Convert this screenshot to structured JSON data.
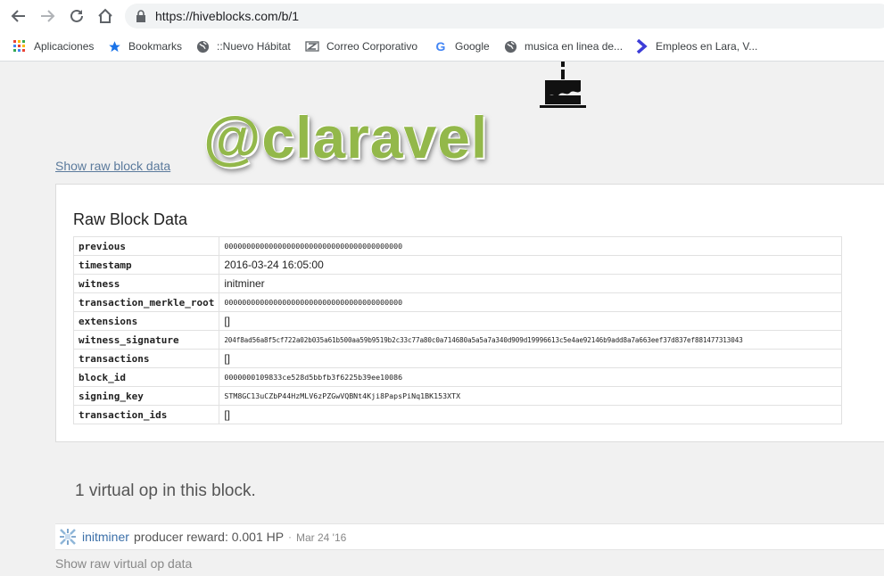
{
  "browser": {
    "url": "https://hiveblocks.com/b/1",
    "bookmarks": [
      {
        "label": "Aplicaciones",
        "icon": "apps-grid-icon"
      },
      {
        "label": "Bookmarks",
        "icon": "star-icon"
      },
      {
        "label": "::Nuevo Hábitat",
        "icon": "globe-icon"
      },
      {
        "label": "Correo Corporativo",
        "icon": "zimbra-icon"
      },
      {
        "label": "Google",
        "icon": "google-icon"
      },
      {
        "label": "musica en linea de...",
        "icon": "globe-icon"
      },
      {
        "label": "Empleos en Lara, V...",
        "icon": "arrow-logo-icon"
      }
    ]
  },
  "page": {
    "watermark": "@claravel",
    "show_raw_block": "Show raw block data",
    "panel_title": "Raw Block Data",
    "rows": [
      {
        "key": "previous",
        "value": "0000000000000000000000000000000000000000"
      },
      {
        "key": "timestamp",
        "value": "2016-03-24 16:05:00"
      },
      {
        "key": "witness",
        "value": "initminer"
      },
      {
        "key": "transaction_merkle_root",
        "value": "0000000000000000000000000000000000000000"
      },
      {
        "key": "extensions",
        "value": "[]"
      },
      {
        "key": "witness_signature",
        "value": "204f8ad56a8f5cf722a02b035a61b500aa59b9519b2c33c77a80c0a714680a5a5a7a340d909d19996613c5e4ae92146b9add8a7a663eef37d837ef881477313043"
      },
      {
        "key": "transactions",
        "value": "[]"
      },
      {
        "key": "block_id",
        "value": "0000000109833ce528d5bbfb3f6225b39ee10086"
      },
      {
        "key": "signing_key",
        "value": "STM8GC13uCZbP44HzMLV6zPZGwVQBNt4Kji8PapsPiNq1BK153XTX"
      },
      {
        "key": "transaction_ids",
        "value": "[]"
      }
    ],
    "virtual_ops_heading": "1 virtual op in this block.",
    "vop": {
      "user": "initminer",
      "text": "producer reward: 0.001 HP",
      "separator": "·",
      "date": "Mar 24 '16"
    },
    "show_raw_vop": "Show raw virtual op data"
  }
}
